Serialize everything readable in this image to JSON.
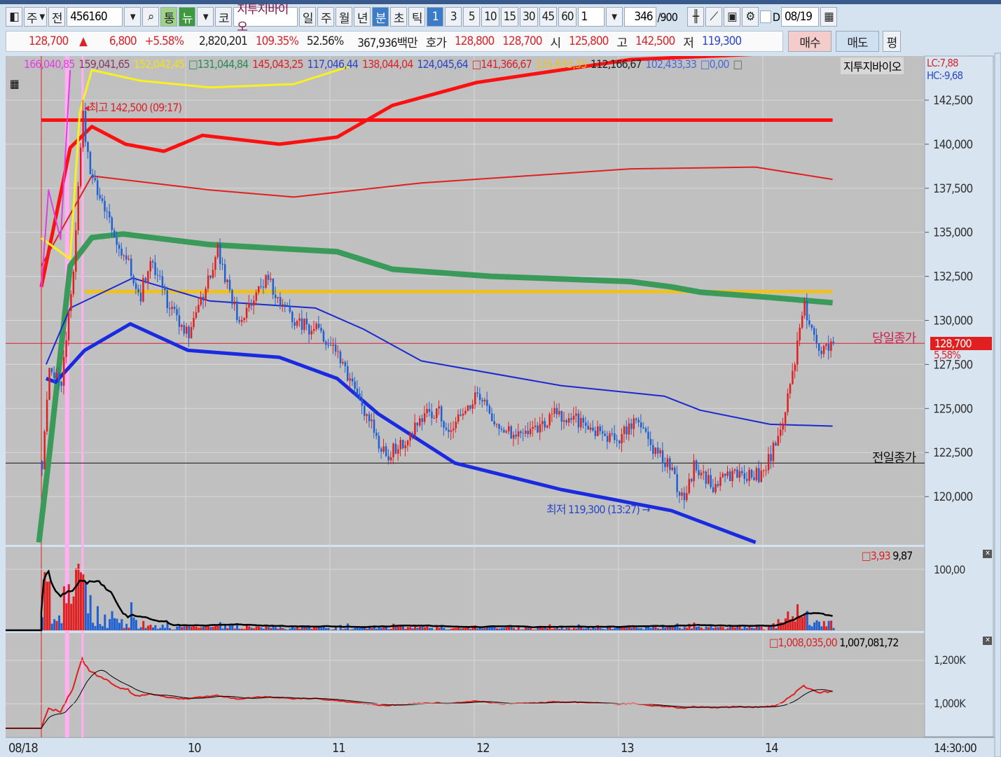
{
  "toolbar": {
    "market": "주",
    "prev": "전",
    "code": "456160",
    "tong": "통",
    "news": "뉴",
    "ko": "코",
    "stock_name": "지투지바이오",
    "periods": [
      "일",
      "주",
      "월",
      "년",
      "분",
      "초",
      "틱"
    ],
    "active_period": "분",
    "minutes": [
      "1",
      "3",
      "5",
      "10",
      "15",
      "30",
      "45",
      "60"
    ],
    "active_minute": "1",
    "interval": "1",
    "count": "346",
    "count_max": "/900",
    "d_label": "D",
    "date": "08/19"
  },
  "quote": {
    "price": "128,700",
    "arrow": "▲",
    "change": "6,800",
    "change_pct": "+5.58%",
    "volume": "2,820,201",
    "vol_ratio": "109.35%",
    "turnover": "52.56%",
    "amount": "367,936백만",
    "hoga_label": "호가",
    "ask": "128,800",
    "bid": "128,700",
    "open_label": "시",
    "open": "125,800",
    "high_label": "고",
    "high": "142,500",
    "low_label": "저",
    "low": "119,300",
    "buy": "매수",
    "sell": "매도",
    "avg": "평"
  },
  "legend": [
    {
      "text": "166,040,85",
      "color": "#e040e0"
    },
    {
      "text": "159,041,65",
      "color": "#8b3a62"
    },
    {
      "text": "152,042,45",
      "color": "#f0e020"
    },
    {
      "text": "□131,044,84",
      "color": "#2e8b57"
    },
    {
      "text": "145,043,25",
      "color": "#d8242b"
    },
    {
      "text": "117,046,44",
      "color": "#2b48c8"
    },
    {
      "text": "138,044,04",
      "color": "#d8242b"
    },
    {
      "text": "124,045,64",
      "color": "#2b48c8"
    },
    {
      "text": "□141,366,67",
      "color": "#d8242b"
    },
    {
      "text": "131,633,33",
      "color": "#f0c020"
    },
    {
      "text": "112,166,67",
      "color": "#222222"
    },
    {
      "text": "102,433,33",
      "color": "#4a6ad8"
    },
    {
      "text": "□0,00",
      "color": "#4a6ad8"
    },
    {
      "text": "□",
      "color": "#666666"
    }
  ],
  "legend_name": "지투지바이오",
  "lc": "LC:7,88",
  "hc": "HC:-9,68",
  "annotations": {
    "high": "최고 142,500 (09:17)",
    "low": "최저 119,300 (13:27)",
    "today_close": "당일종가",
    "prev_close": "전일종가",
    "last_price": "128,700",
    "last_pct": "5,58%"
  },
  "volume_panel": {
    "legend1": "□3,93",
    "legend2": "9,87",
    "tick": "100,00"
  },
  "obv_panel": {
    "legend1": "□1,008,035,00",
    "legend2": "1,007,081,72",
    "ticks": [
      "1,200K",
      "1,000K"
    ]
  },
  "colors": {
    "up": "#e02020",
    "down": "#2060d0",
    "bg": "#c0c0c0"
  },
  "chart_data": {
    "type": "candlestick",
    "title": "지투지바이오 1분",
    "x_unit": "minutes since 09:00",
    "xticks": [
      {
        "label": "08/18",
        "min": 0
      },
      {
        "label": "10",
        "min": 60
      },
      {
        "label": "11",
        "min": 120
      },
      {
        "label": "12",
        "min": 180
      },
      {
        "label": "13",
        "min": 240
      },
      {
        "label": "14",
        "min": 300
      }
    ],
    "x_end_label": "14:30:00",
    "xlim": [
      -15,
      370
    ],
    "ylim": [
      116900,
      144900
    ],
    "yticks": [
      120000,
      122500,
      125000,
      127500,
      130000,
      132500,
      135000,
      137500,
      140000,
      142500
    ],
    "ytick_labels": [
      "120,000",
      "122,500",
      "125,000",
      "127,500",
      "130,000",
      "132,500",
      "135,000",
      "137,500",
      "140,000",
      "142,500"
    ],
    "prev_close": 121900,
    "last_close": 128700,
    "high": {
      "min": 17,
      "price": 142500
    },
    "low": {
      "min": 267,
      "price": 119300
    },
    "price_path": [
      [
        0,
        122000
      ],
      [
        3,
        127000
      ],
      [
        8,
        126500
      ],
      [
        13,
        133000
      ],
      [
        17,
        141500
      ],
      [
        20,
        138000
      ],
      [
        26,
        136500
      ],
      [
        33,
        134000
      ],
      [
        41,
        131500
      ],
      [
        45,
        133500
      ],
      [
        53,
        130700
      ],
      [
        61,
        129100
      ],
      [
        73,
        133900
      ],
      [
        82,
        129900
      ],
      [
        93,
        132300
      ],
      [
        105,
        130100
      ],
      [
        120,
        128900
      ],
      [
        131,
        125900
      ],
      [
        140,
        123100
      ],
      [
        144,
        122300
      ],
      [
        158,
        124300
      ],
      [
        165,
        125100
      ],
      [
        169,
        123500
      ],
      [
        181,
        125700
      ],
      [
        190,
        123900
      ],
      [
        200,
        123300
      ],
      [
        213,
        124700
      ],
      [
        225,
        124300
      ],
      [
        238,
        123100
      ],
      [
        246,
        124100
      ],
      [
        259,
        122100
      ],
      [
        267,
        119800
      ],
      [
        271,
        121800
      ],
      [
        278,
        120600
      ],
      [
        287,
        121200
      ],
      [
        300,
        121200
      ],
      [
        308,
        124300
      ],
      [
        317,
        130700
      ],
      [
        323,
        128000
      ],
      [
        329,
        128700
      ]
    ],
    "series": [
      {
        "name": "level-high",
        "color": "#ff1010",
        "width": 5,
        "points": [
          [
            0,
            141366
          ],
          [
            329,
            141366
          ]
        ]
      },
      {
        "name": "level-mid",
        "color": "#f0c020",
        "width": 5,
        "points": [
          [
            18,
            131633
          ],
          [
            329,
            131633
          ]
        ]
      },
      {
        "name": "ma-green",
        "color": "#3a9a5a",
        "width": 8,
        "points": [
          [
            -1,
            117400
          ],
          [
            3,
            122000
          ],
          [
            12,
            133100
          ],
          [
            21,
            134700
          ],
          [
            34,
            134900
          ],
          [
            70,
            134300
          ],
          [
            123,
            133900
          ],
          [
            146,
            132900
          ],
          [
            187,
            132500
          ],
          [
            245,
            132200
          ],
          [
            262,
            131900
          ],
          [
            274,
            131600
          ],
          [
            303,
            131300
          ],
          [
            329,
            131000
          ]
        ]
      },
      {
        "name": "upper-red-thick",
        "color": "#ff1010",
        "width": 5,
        "points": [
          [
            0,
            131900
          ],
          [
            12,
            139800
          ],
          [
            21,
            141000
          ],
          [
            35,
            140000
          ],
          [
            51,
            139600
          ],
          [
            67,
            140500
          ],
          [
            99,
            140000
          ],
          [
            123,
            140400
          ],
          [
            146,
            142200
          ],
          [
            181,
            143500
          ],
          [
            245,
            144800
          ],
          [
            329,
            145300
          ]
        ]
      },
      {
        "name": "upper-red-thin",
        "color": "#e02020",
        "width": 2,
        "points": [
          [
            0,
            133100
          ],
          [
            21,
            138200
          ],
          [
            70,
            137400
          ],
          [
            105,
            137000
          ],
          [
            158,
            137800
          ],
          [
            245,
            138600
          ],
          [
            297,
            138700
          ],
          [
            329,
            138000
          ]
        ]
      },
      {
        "name": "lower-blue-thin",
        "color": "#1a2ad0",
        "width": 2,
        "points": [
          [
            2,
            127500
          ],
          [
            12,
            130700
          ],
          [
            38,
            132400
          ],
          [
            70,
            131100
          ],
          [
            114,
            130700
          ],
          [
            134,
            129500
          ],
          [
            158,
            127700
          ],
          [
            216,
            126300
          ],
          [
            259,
            125700
          ],
          [
            274,
            124900
          ],
          [
            303,
            124100
          ],
          [
            329,
            124000
          ]
        ]
      },
      {
        "name": "lower-blue-thick",
        "color": "#1a2ae0",
        "width": 5,
        "points": [
          [
            2,
            126700
          ],
          [
            6,
            126500
          ],
          [
            18,
            128300
          ],
          [
            37,
            129800
          ],
          [
            61,
            128300
          ],
          [
            99,
            127900
          ],
          [
            123,
            126700
          ],
          [
            140,
            124700
          ],
          [
            172,
            121900
          ],
          [
            216,
            120400
          ],
          [
            262,
            119200
          ],
          [
            297,
            117400
          ]
        ]
      },
      {
        "name": "yellow",
        "color": "#f8f020",
        "width": 3,
        "points": [
          [
            0,
            134670
          ],
          [
            12,
            133480
          ],
          [
            16,
            141820
          ],
          [
            21,
            144210
          ],
          [
            41,
            143610
          ],
          [
            70,
            143220
          ],
          [
            105,
            143410
          ],
          [
            128,
            144410
          ]
        ]
      },
      {
        "name": "magenta",
        "color": "#e040e0",
        "width": 2,
        "points": [
          [
            0,
            131800
          ],
          [
            3,
            137400
          ],
          [
            8,
            134600
          ],
          [
            12,
            144200
          ]
        ]
      }
    ]
  }
}
